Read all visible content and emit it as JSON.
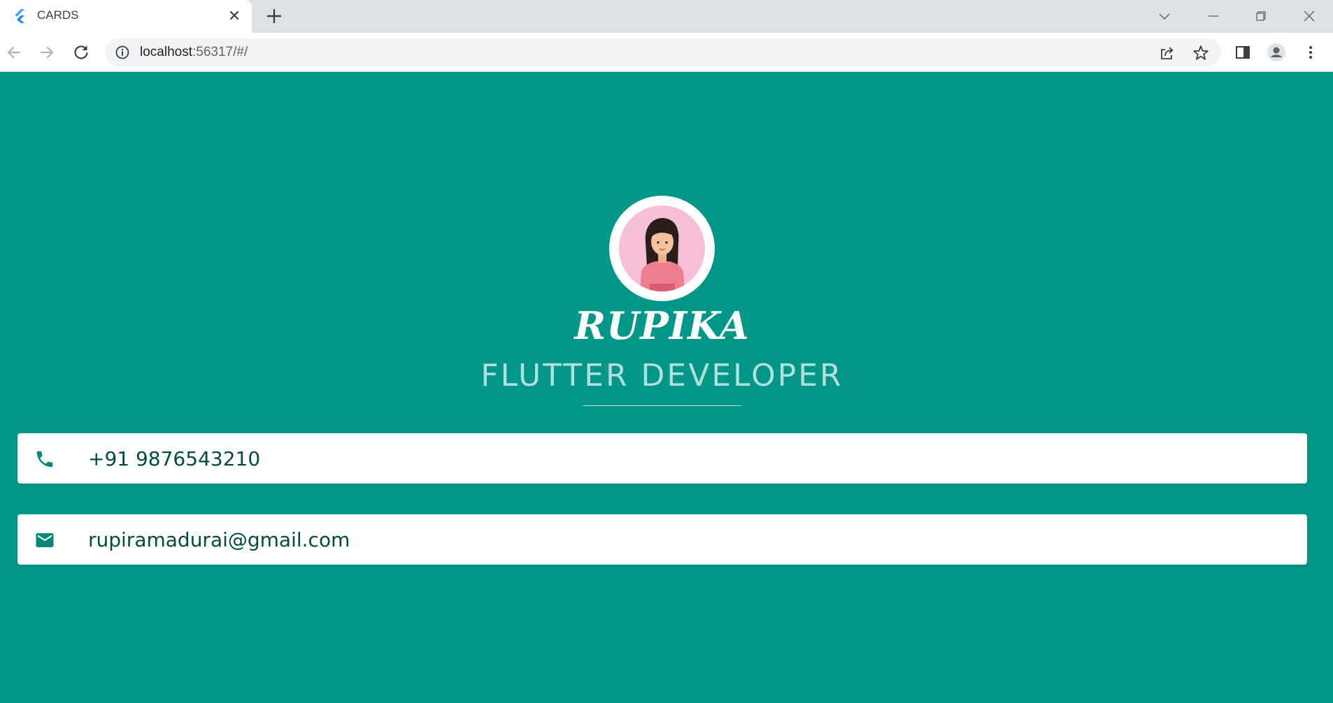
{
  "browser": {
    "tab_title": "CARDS",
    "url_host": "localhost",
    "url_rest": ":56317/#/"
  },
  "profile": {
    "name": "RUPIKA",
    "role": "FLUTTER DEVELOPER",
    "phone": "+91 9876543210",
    "email": "rupiramadurai@gmail.com"
  },
  "colors": {
    "background": "#009688",
    "card": "#ffffff",
    "accent_text": "#004d40",
    "role_text": "#b2dfdb",
    "avatar_bg": "#f7bfd7"
  },
  "icons": [
    "flutter-icon",
    "close-icon",
    "plus-icon",
    "back-icon",
    "forward-icon",
    "reload-icon",
    "info-icon",
    "share-icon",
    "star-icon",
    "sidepanel-icon",
    "profile-icon",
    "menu-icon",
    "phone-icon",
    "mail-icon"
  ]
}
